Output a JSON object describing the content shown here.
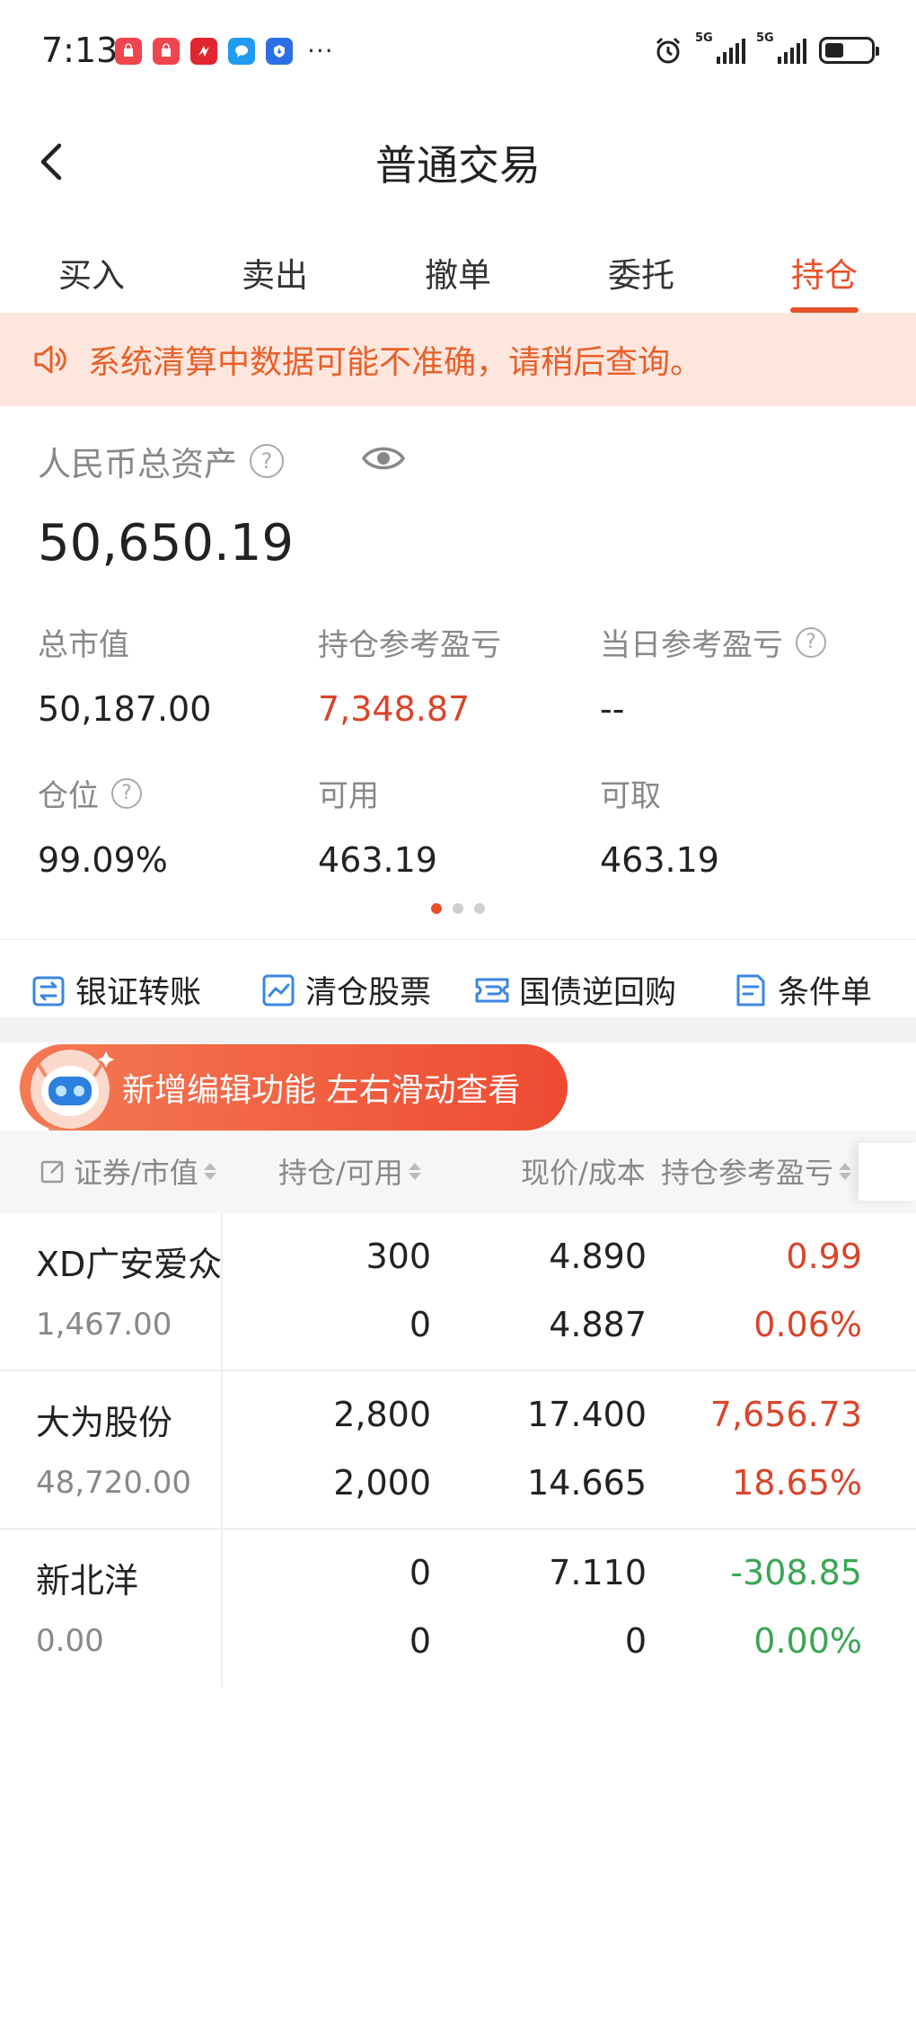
{
  "status_bar": {
    "time": "7:13",
    "more": "···",
    "network": [
      "5G",
      "5G"
    ]
  },
  "header": {
    "title": "普通交易"
  },
  "tabs": [
    {
      "label": "买入",
      "active": false
    },
    {
      "label": "卖出",
      "active": false
    },
    {
      "label": "撤单",
      "active": false
    },
    {
      "label": "委托",
      "active": false
    },
    {
      "label": "持仓",
      "active": true
    }
  ],
  "notice": {
    "text": "系统清算中数据可能不准确，请稍后查询。"
  },
  "assets": {
    "label": "人民币总资产",
    "total": "50,650.19",
    "stats": [
      {
        "label": "总市值",
        "value": "50,187.00"
      },
      {
        "label": "持仓参考盈亏",
        "value": "7,348.87"
      },
      {
        "label": "当日参考盈亏",
        "value": "--"
      },
      {
        "label": "仓位",
        "value": "99.09%"
      },
      {
        "label": "可用",
        "value": "463.19"
      },
      {
        "label": "可取",
        "value": "463.19"
      }
    ]
  },
  "quick_actions": [
    "银证转账",
    "清仓股票",
    "国债逆回购",
    "条件单"
  ],
  "promo": {
    "text": "新增编辑功能 左右滑动查看"
  },
  "table": {
    "headers": [
      "证券/市值",
      "持仓/可用",
      "现价/成本",
      "持仓参考盈亏"
    ],
    "rows": [
      {
        "name": "XD广安爱众",
        "market_value": "1,467.00",
        "holding": "300",
        "available": "0",
        "price": "4.890",
        "cost": "4.887",
        "pl": "0.99",
        "pl_pct": "0.06%",
        "trend": "up"
      },
      {
        "name": "大为股份",
        "market_value": "48,720.00",
        "holding": "2,800",
        "available": "2,000",
        "price": "17.400",
        "cost": "14.665",
        "pl": "7,656.73",
        "pl_pct": "18.65%",
        "trend": "up"
      },
      {
        "name": "新北洋",
        "market_value": "0.00",
        "holding": "0",
        "available": "0",
        "price": "7.110",
        "cost": "0",
        "pl": "-308.85",
        "pl_pct": "0.00%",
        "trend": "down"
      }
    ]
  },
  "colors": {
    "accent": "#e8502a",
    "gain": "#d9452a",
    "loss": "#3aa655",
    "notice_bg": "#fde6dd"
  }
}
